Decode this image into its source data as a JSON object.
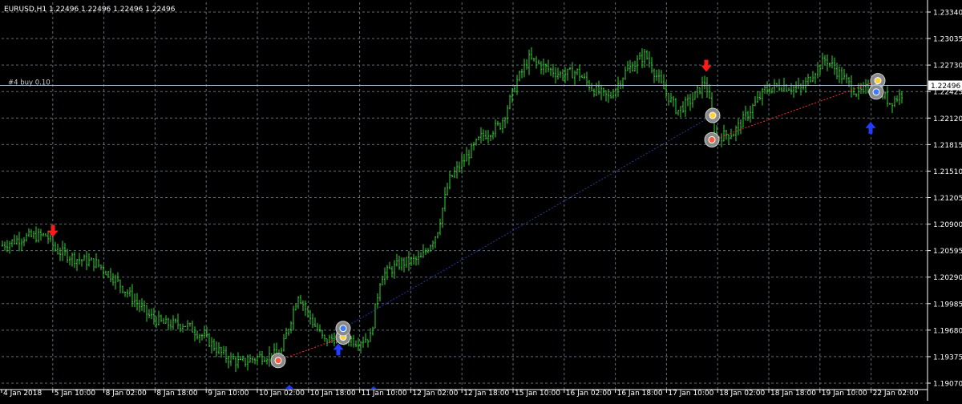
{
  "window": {
    "symbol_header": "EURUSD,H1  1.22496 1.22496 1.22496 1.22496",
    "position_label": "#4 buy 0.10",
    "current_price_label": "1.22496"
  },
  "colors": {
    "background": "#000000",
    "grid": "#5f6b74",
    "bars": "#2fd32f",
    "axis_text": "#ffffff",
    "buy_arrow": "#1f3cff",
    "sell_arrow": "#ff1a1a",
    "current_price_line": "#b8c3d6",
    "trade_line_buy": "#1a2bff",
    "trade_line_sell": "#ff2a2a"
  },
  "chart_data": {
    "type": "candlestick",
    "symbol": "EURUSD",
    "timeframe": "H1",
    "y_ticks": [
      "1.23340",
      "1.23035",
      "1.22730",
      "1.22425",
      "1.22120",
      "1.21815",
      "1.21510",
      "1.21205",
      "1.20900",
      "1.20595",
      "1.20290",
      "1.19985",
      "1.19680",
      "1.19375",
      "1.19070"
    ],
    "ylim": [
      1.1907,
      1.2334
    ],
    "x_ticks": [
      "4 Jan 2018",
      "5 Jan 10:00",
      "8 Jan 02:00",
      "8 Jan 18:00",
      "9 Jan 10:00",
      "10 Jan 02:00",
      "10 Jan 18:00",
      "11 Jan 10:00",
      "12 Jan 02:00",
      "12 Jan 18:00",
      "15 Jan 10:00",
      "16 Jan 02:00",
      "16 Jan 18:00",
      "17 Jan 10:00",
      "18 Jan 02:00",
      "18 Jan 18:00",
      "19 Jan 10:00",
      "22 Jan 02:00"
    ],
    "current_price": 1.22496,
    "price_path": [
      [
        0,
        1.2065
      ],
      [
        30,
        1.2075
      ],
      [
        58,
        1.2077
      ],
      [
        70,
        1.206
      ],
      [
        95,
        1.205
      ],
      [
        120,
        1.2045
      ],
      [
        140,
        1.203
      ],
      [
        160,
        1.201
      ],
      [
        185,
        1.1985
      ],
      [
        205,
        1.1975
      ],
      [
        230,
        1.1975
      ],
      [
        255,
        1.196
      ],
      [
        280,
        1.1938
      ],
      [
        300,
        1.193
      ],
      [
        325,
        1.1938
      ],
      [
        350,
        1.194
      ],
      [
        372,
        1.201
      ],
      [
        385,
        1.1985
      ],
      [
        405,
        1.1955
      ],
      [
        425,
        1.1962
      ],
      [
        445,
        1.1955
      ],
      [
        462,
        1.196
      ],
      [
        475,
        1.203
      ],
      [
        500,
        1.2045
      ],
      [
        525,
        1.205
      ],
      [
        545,
        1.208
      ],
      [
        560,
        1.214
      ],
      [
        580,
        1.2165
      ],
      [
        600,
        1.219
      ],
      [
        625,
        1.2205
      ],
      [
        645,
        1.2255
      ],
      [
        660,
        1.228
      ],
      [
        680,
        1.227
      ],
      [
        700,
        1.2262
      ],
      [
        720,
        1.2265
      ],
      [
        740,
        1.2245
      ],
      [
        760,
        1.2235
      ],
      [
        780,
        1.2265
      ],
      [
        805,
        1.2285
      ],
      [
        825,
        1.225
      ],
      [
        845,
        1.222
      ],
      [
        865,
        1.2235
      ],
      [
        880,
        1.2255
      ],
      [
        893,
        1.219
      ],
      [
        915,
        1.2195
      ],
      [
        935,
        1.222
      ],
      [
        955,
        1.2245
      ],
      [
        975,
        1.225
      ],
      [
        1000,
        1.2245
      ],
      [
        1015,
        1.2265
      ],
      [
        1030,
        1.228
      ],
      [
        1050,
        1.226
      ],
      [
        1070,
        1.224
      ],
      [
        1090,
        1.225
      ],
      [
        1110,
        1.223
      ],
      [
        1125,
        1.224
      ]
    ],
    "arrows": [
      {
        "kind": "sell",
        "x_index": 66,
        "price": 1.2078
      },
      {
        "kind": "buy",
        "x_index": 422,
        "price": 1.195
      },
      {
        "kind": "sell",
        "x_index": 881,
        "price": 1.2268
      },
      {
        "kind": "buy",
        "x_index": 1086,
        "price": 1.2205
      }
    ],
    "trade_markers": [
      {
        "x_index": 347,
        "price": 1.1933,
        "color": "#ff5a3c"
      },
      {
        "x_index": 428,
        "price": 1.196,
        "color": "#ffd23c"
      },
      {
        "x_index": 428,
        "price": 1.197,
        "color": "#3c7dff"
      },
      {
        "x_index": 889,
        "price": 1.2215,
        "color": "#ffd23c"
      },
      {
        "x_index": 888,
        "price": 1.2187,
        "color": "#ff5a3c"
      },
      {
        "x_index": 1095,
        "price": 1.2255,
        "color": "#ffd23c"
      },
      {
        "x_index": 1093,
        "price": 1.2242,
        "color": "#3c7dff"
      }
    ],
    "trade_lines": [
      {
        "from": [
          347,
          1.1933
        ],
        "to": [
          428,
          1.196
        ],
        "color": "#ff2a2a"
      },
      {
        "from": [
          428,
          1.197
        ],
        "to": [
          889,
          1.2215
        ],
        "color": "#1a2bff"
      },
      {
        "from": [
          888,
          1.2187
        ],
        "to": [
          1095,
          1.2255
        ],
        "color": "#ff2a2a"
      }
    ]
  }
}
